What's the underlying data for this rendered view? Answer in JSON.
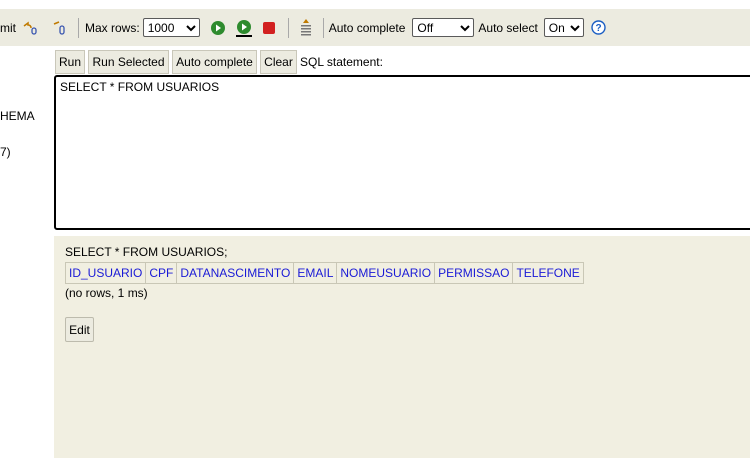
{
  "toolbar": {
    "commit_partial": "mit",
    "max_rows_label": "Max rows:",
    "max_rows_value": "1000",
    "auto_complete_label": "Auto complete",
    "auto_complete_value": "Off",
    "auto_select_label": "Auto select",
    "auto_select_value": "On",
    "colors": {
      "run_green": "#2e8b2e",
      "stop_red": "#d22020",
      "help_blue": "#1c5fc4"
    }
  },
  "sidebar": {
    "item1_partial": "HEMA",
    "item2_partial": "7)"
  },
  "buttons": {
    "run": "Run",
    "run_selected": "Run Selected",
    "auto_complete": "Auto complete",
    "clear": "Clear"
  },
  "sql_label": "SQL statement:",
  "editor": {
    "value": "SELECT * FROM USUARIOS"
  },
  "results": {
    "statement": "SELECT * FROM USUARIOS;",
    "columns": [
      "ID_USUARIO",
      "CPF",
      "DATANASCIMENTO",
      "EMAIL",
      "NOMEUSUARIO",
      "PERMISSAO",
      "TELEFONE"
    ],
    "info": "(no rows, 1 ms)",
    "edit_label": "Edit"
  }
}
